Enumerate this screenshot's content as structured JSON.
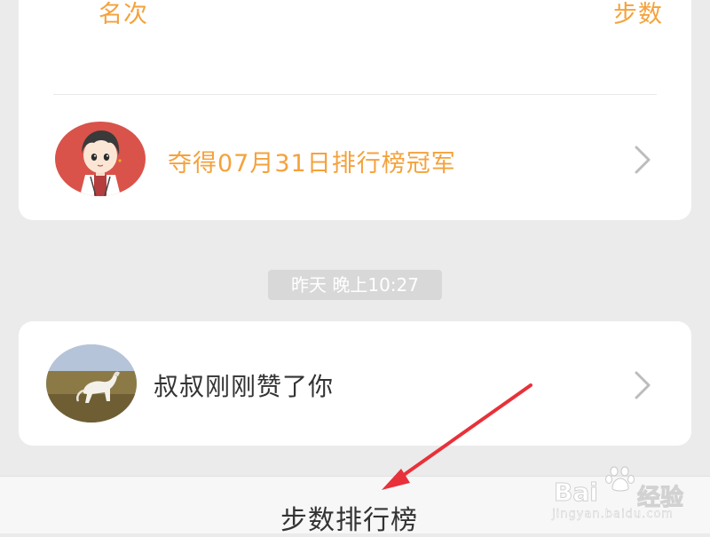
{
  "header": {
    "rank_label": "名次",
    "steps_label": "步数"
  },
  "champion_row": {
    "text": "夺得07月31日排行榜冠军",
    "avatar_icon": "cartoon-boy-avatar",
    "chevron_icon": "chevron-right-icon"
  },
  "timestamp": "昨天 晚上10:27",
  "like_row": {
    "text": "叔叔刚刚赞了你",
    "avatar_icon": "white-horse-avatar",
    "chevron_icon": "chevron-right-icon"
  },
  "bottom_tab": {
    "label": "步数排行榜"
  },
  "watermark": {
    "brand_left": "Bai",
    "brand_right": "经验",
    "url": "jingyan.baidu.com"
  },
  "colors": {
    "accent": "#f4a23c",
    "background": "#ebebeb",
    "card": "#ffffff",
    "arrow": "#e8313a"
  }
}
